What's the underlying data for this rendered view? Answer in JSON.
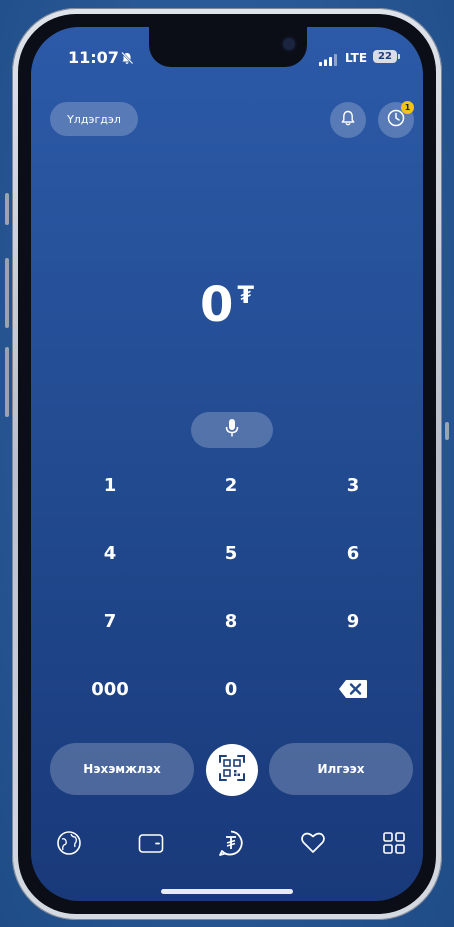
{
  "status_bar": {
    "time": "11:07",
    "network": "LTE",
    "battery": "22"
  },
  "header": {
    "left_pill_label": "Үлдэгдэл",
    "notification_badge": "1"
  },
  "amount": {
    "value": "0",
    "currency": "₮"
  },
  "keypad": {
    "keys": [
      "1",
      "2",
      "3",
      "4",
      "5",
      "6",
      "7",
      "8",
      "9",
      "000",
      "0"
    ]
  },
  "actions": {
    "request_label": "Нэхэмжлэх",
    "send_label": "Илгээх"
  },
  "icons": {
    "mute": "bell-slash-icon",
    "signal": "signal-bars-icon",
    "notifications": "bell-icon",
    "history": "clock-icon",
    "microphone": "microphone-icon",
    "delete": "backspace-icon",
    "qr": "qr-code-icon",
    "nav": [
      "globe-icon",
      "wallet-icon",
      "tugrik-icon",
      "heart-icon",
      "grid-icon"
    ]
  },
  "colors": {
    "screen_top": "#2c5aa8",
    "screen_bottom": "#19397a",
    "badge": "#f4c21b",
    "white": "#ffffff"
  }
}
